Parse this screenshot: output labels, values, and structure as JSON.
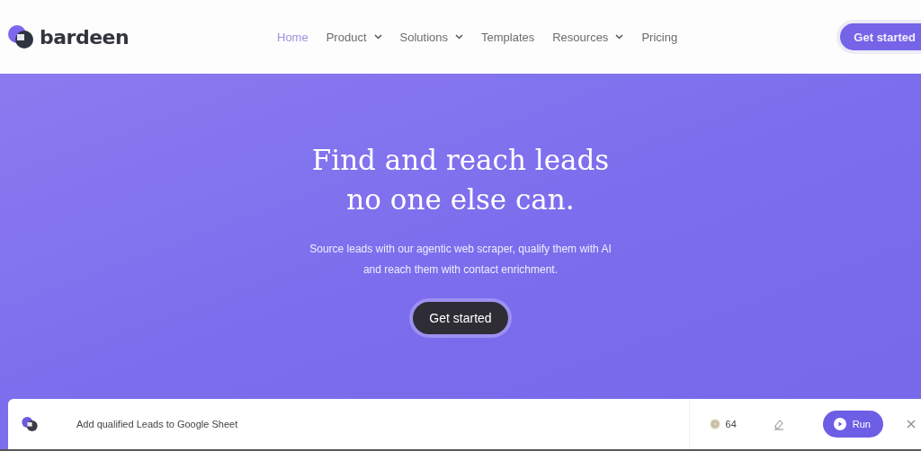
{
  "header": {
    "logo": "bardeen",
    "nav": [
      {
        "label": "Home",
        "selected": true,
        "dropdown": false
      },
      {
        "label": "Product",
        "selected": false,
        "dropdown": true
      },
      {
        "label": "Solutions",
        "selected": false,
        "dropdown": true
      },
      {
        "label": "Templates",
        "selected": false,
        "dropdown": false
      },
      {
        "label": "Resources",
        "selected": false,
        "dropdown": true
      },
      {
        "label": "Pricing",
        "selected": false,
        "dropdown": false
      }
    ],
    "cta": "Get started"
  },
  "hero": {
    "title_lines": [
      "Find and reach leads",
      "no one else can."
    ],
    "subtitle_lines": [
      "Source leads with our agentic web scraper, qualify them with AI",
      "and reach them with contact enrichment."
    ],
    "cta": "Get started"
  },
  "playbook": {
    "name": "Add qualified Leads to Google Sheet",
    "credits": "64",
    "run": "Run"
  }
}
